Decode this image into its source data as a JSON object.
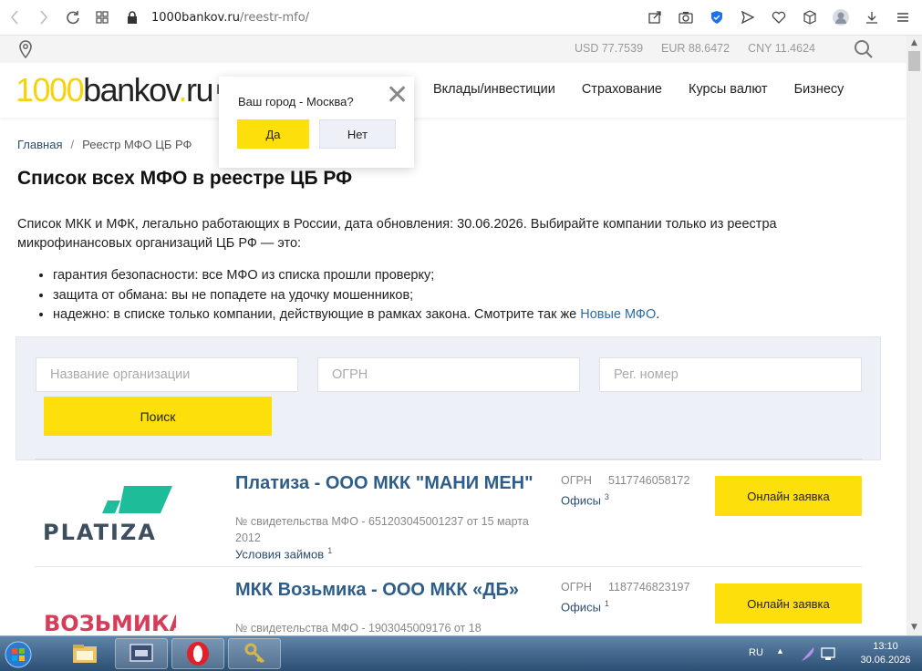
{
  "browser": {
    "url_domain": "1000bankov.ru",
    "url_path": "/reestr-mfo/"
  },
  "site_top": {
    "rates": [
      "USD 77.7539",
      "EUR 88.6472",
      "CNY 11.4624"
    ]
  },
  "header": {
    "logo_num": "1000",
    "logo_word": "bankov",
    "logo_dot": ".",
    "logo_tld": "ru",
    "nav_stub": "I",
    "nav": [
      "Вклады/инвестиции",
      "Страхование",
      "Курсы валют",
      "Бизнесу"
    ]
  },
  "city_popup": {
    "question": "Ваш город - Москва?",
    "yes": "Да",
    "no": "Нет"
  },
  "breadcrumb": {
    "home": "Главная",
    "separator": "/",
    "current": "Реестр МФО ЦБ РФ"
  },
  "page": {
    "title": "Список всех МФО в реестре ЦБ РФ",
    "intro": "Список МКК и МФК, легально работающих в России, дата обновления: 30.06.2026. Выбирайте компании только из реестра микрофинансовых организаций ЦБ РФ —  это:",
    "bullets": [
      "гарантия безопасности: все МФО из списка прошли проверку;",
      "защита от обмана: вы не попадете на удочку мошенников;",
      "надежно: в списке только компании, действующие в рамках закона. Смотрите так же "
    ],
    "bullet_link": "Новые МФО",
    "bullet_link_tail": "."
  },
  "search": {
    "name_placeholder": "Название организации",
    "ogrn_placeholder": "ОГРН",
    "reg_placeholder": "Рег. номер",
    "button": "Поиск"
  },
  "listing": [
    {
      "logo_text": "PLATIZA",
      "name": "Платиза - ООО МКК \"МАНИ МЕН\"",
      "cert": "№ свидетельства МФО - 651203045001237 от 15 марта 2012",
      "terms": "Условия займов",
      "terms_count": "1",
      "ogrn_label": "ОГРН",
      "ogrn": "5117746058172",
      "offices": "Офисы",
      "offices_count": "3",
      "apply": "Онлайн заявка"
    },
    {
      "logo_text": "ВОЗЬМИКА",
      "name": "МКК Возьмика - ООО МКК «ДБ»",
      "cert": "№ свидетельства МФО - 1903045009176 от 18",
      "ogrn_label": "ОГРН",
      "ogrn": "1187746823197",
      "offices": "Офисы",
      "offices_count": "1",
      "apply": "Онлайн заявка"
    }
  ],
  "taskbar": {
    "lang": "RU",
    "time": "13:10",
    "date": "30.06.2026"
  },
  "colors": {
    "accent_yellow": "#fddf0c",
    "link_blue": "#2f5d8a",
    "platiza_green": "#1dbd9a",
    "platiza_dark": "#3d4e5e",
    "vozmika_red": "#d63d5a"
  }
}
